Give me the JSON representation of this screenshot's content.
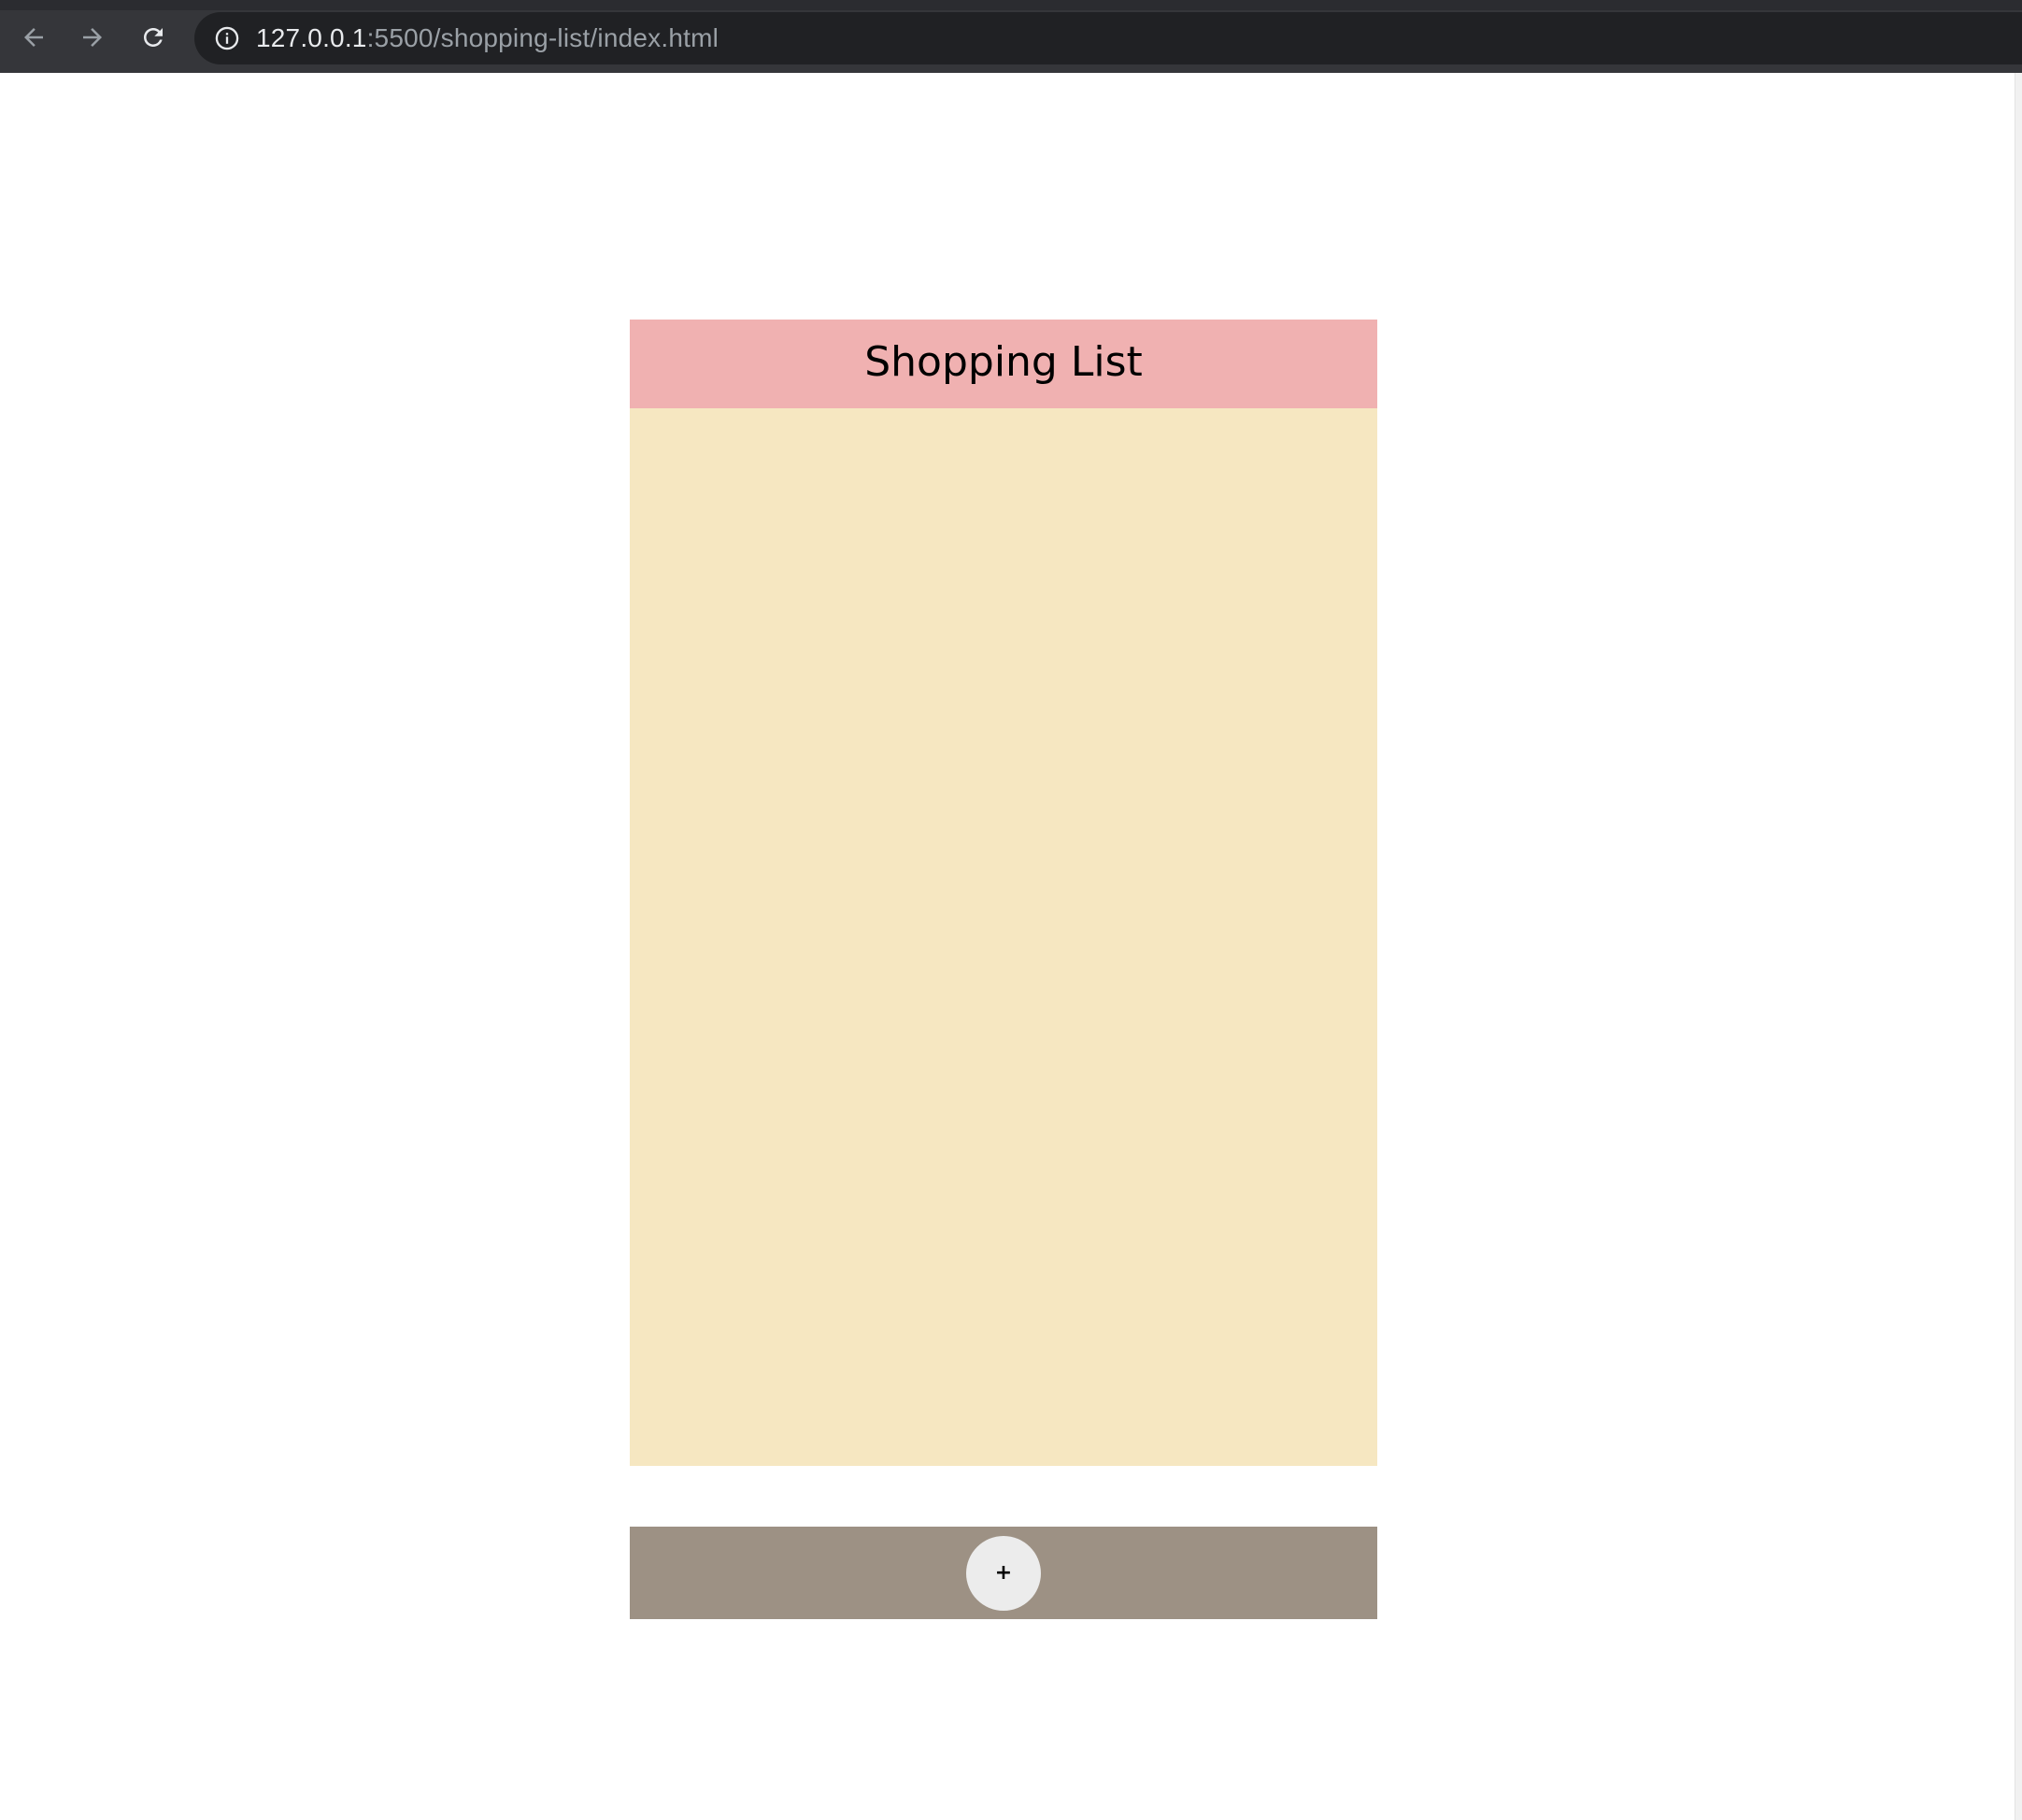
{
  "browser": {
    "url_host": "127.0.0.1",
    "url_rest": ":5500/shopping-list/index.html",
    "back_icon": "arrow-left-icon",
    "forward_icon": "arrow-right-icon",
    "reload_icon": "reload-icon",
    "info_icon": "info-icon"
  },
  "app": {
    "title": "Shopping List",
    "items": [],
    "add_button_label": "+"
  },
  "colors": {
    "header_bg": "#f0b1b1",
    "list_bg": "#f6e7c1",
    "footer_bg": "#9d9184",
    "add_button_bg": "#ececec"
  }
}
